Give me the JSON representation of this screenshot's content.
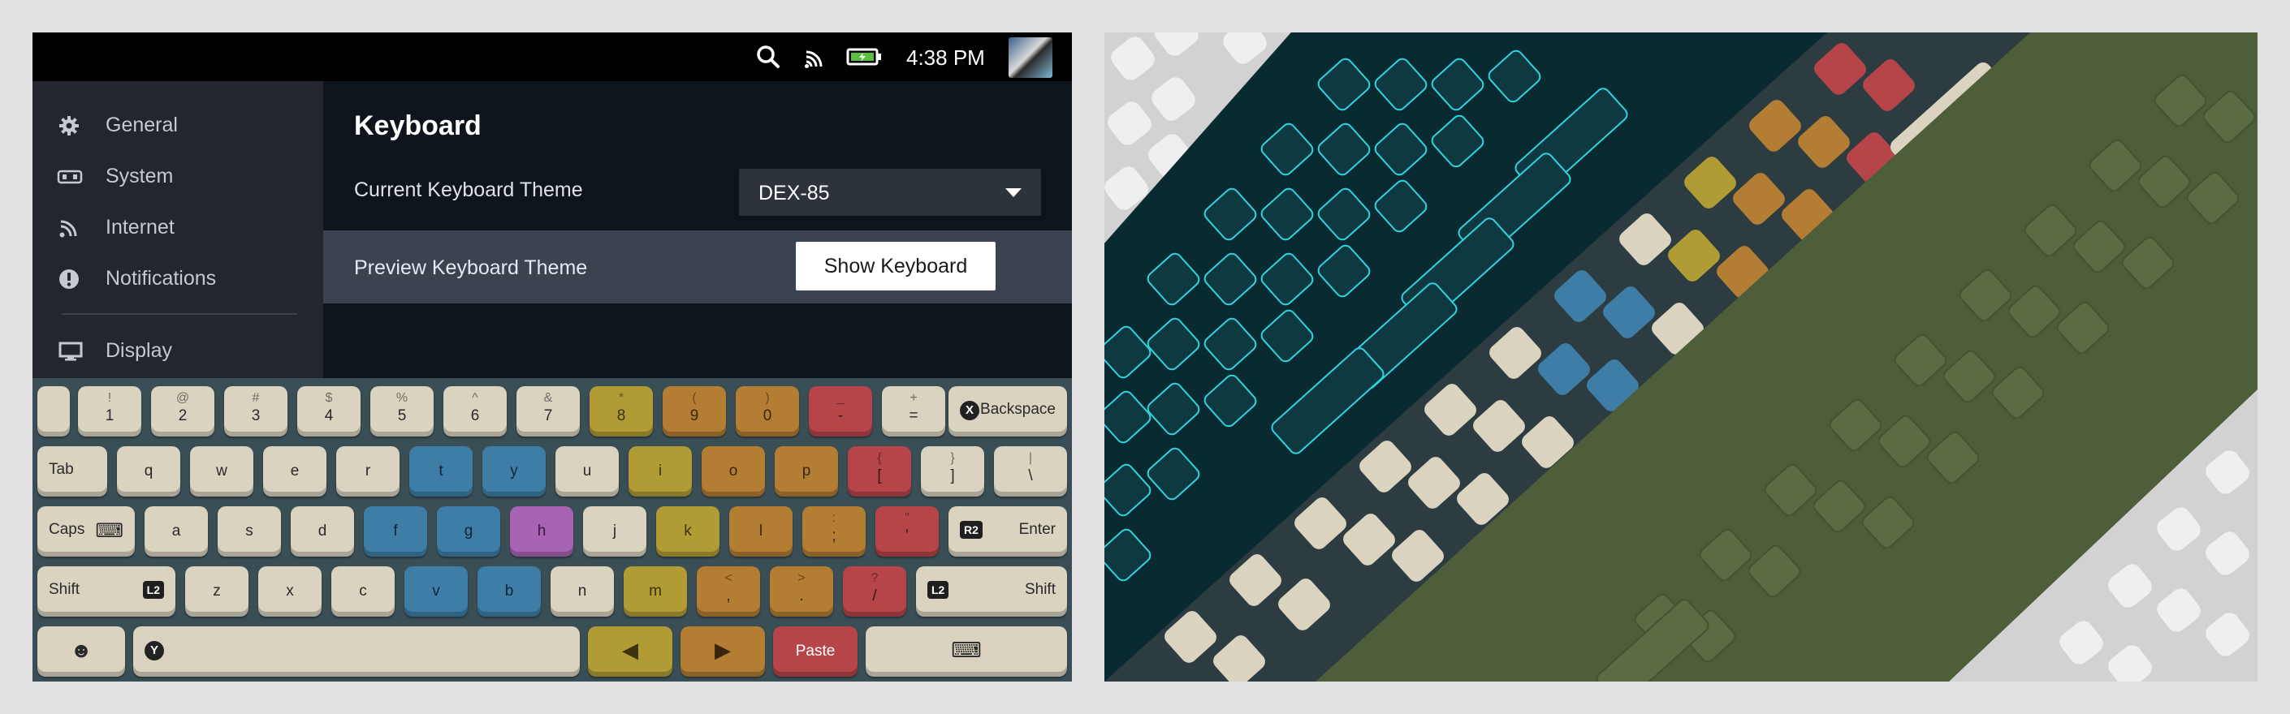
{
  "status_bar": {
    "time": "4:38 PM",
    "icons": [
      "search-icon",
      "cast-icon",
      "battery-charging-icon"
    ]
  },
  "sidebar": {
    "items": [
      {
        "label": "General",
        "icon": "gear-icon"
      },
      {
        "label": "System",
        "icon": "system-icon"
      },
      {
        "label": "Internet",
        "icon": "wifi-icon"
      },
      {
        "label": "Notifications",
        "icon": "alert-icon"
      },
      {
        "label": "Display",
        "icon": "monitor-icon"
      }
    ]
  },
  "main": {
    "title": "Keyboard",
    "theme_label": "Current Keyboard Theme",
    "theme_value": "DEX-85",
    "preview_label": "Preview Keyboard Theme",
    "show_button": "Show Keyboard"
  },
  "colors": {
    "cream": "#d9d3c0",
    "yellow": "#b09b34",
    "orange": "#b37d33",
    "red": "#b6454a",
    "blue": "#3e7ea6",
    "purple": "#a963b4",
    "neon": "#22d3e0",
    "olive": "#4f5e3a"
  },
  "keyboard": {
    "rows": [
      [
        {
          "main": "1",
          "top": "!"
        },
        {
          "main": "2",
          "top": "@"
        },
        {
          "main": "3",
          "top": "#"
        },
        {
          "main": "4",
          "top": "$"
        },
        {
          "main": "5",
          "top": "%"
        },
        {
          "main": "6",
          "top": "^"
        },
        {
          "main": "7",
          "top": "&"
        },
        {
          "main": "8",
          "top": "*"
        },
        {
          "main": "9",
          "top": "("
        },
        {
          "main": "0",
          "top": ")"
        },
        {
          "main": "-",
          "top": "_"
        },
        {
          "main": "=",
          "top": "+"
        },
        {
          "main": "Backspace",
          "top": ""
        }
      ],
      [
        {
          "main": "Tab",
          "top": ""
        },
        {
          "main": "q",
          "top": ""
        },
        {
          "main": "w",
          "top": ""
        },
        {
          "main": "e",
          "top": ""
        },
        {
          "main": "r",
          "top": ""
        },
        {
          "main": "t",
          "top": ""
        },
        {
          "main": "y",
          "top": ""
        },
        {
          "main": "u",
          "top": ""
        },
        {
          "main": "i",
          "top": ""
        },
        {
          "main": "o",
          "top": ""
        },
        {
          "main": "p",
          "top": ""
        },
        {
          "main": "[",
          "top": "{"
        },
        {
          "main": "]",
          "top": "}"
        },
        {
          "main": "\\",
          "top": "|"
        }
      ],
      [
        {
          "main": "Caps",
          "top": ""
        },
        {
          "main": "a",
          "top": ""
        },
        {
          "main": "s",
          "top": ""
        },
        {
          "main": "d",
          "top": ""
        },
        {
          "main": "f",
          "top": ""
        },
        {
          "main": "g",
          "top": ""
        },
        {
          "main": "h",
          "top": ""
        },
        {
          "main": "j",
          "top": ""
        },
        {
          "main": "k",
          "top": ""
        },
        {
          "main": "l",
          "top": ""
        },
        {
          "main": ";",
          "top": ":"
        },
        {
          "main": "'",
          "top": "\""
        },
        {
          "main": "Enter",
          "top": ""
        }
      ],
      [
        {
          "main": "Shift",
          "top": ""
        },
        {
          "main": "z",
          "top": ""
        },
        {
          "main": "x",
          "top": ""
        },
        {
          "main": "c",
          "top": ""
        },
        {
          "main": "v",
          "top": ""
        },
        {
          "main": "b",
          "top": ""
        },
        {
          "main": "n",
          "top": ""
        },
        {
          "main": "m",
          "top": ""
        },
        {
          "main": ",",
          "top": "<"
        },
        {
          "main": ".",
          "top": ">"
        },
        {
          "main": "/",
          "top": "?"
        },
        {
          "main": "Shift",
          "top": ""
        }
      ],
      [
        {
          "main": "",
          "top": ""
        },
        {
          "main": "",
          "top": ""
        },
        {
          "main": "",
          "top": ""
        },
        {
          "main": "",
          "top": ""
        },
        {
          "main": "Paste",
          "top": ""
        },
        {
          "main": "",
          "top": ""
        }
      ]
    ],
    "badges": {
      "r2": "R2",
      "l2": "L2",
      "x": "X",
      "y": "Y"
    }
  }
}
